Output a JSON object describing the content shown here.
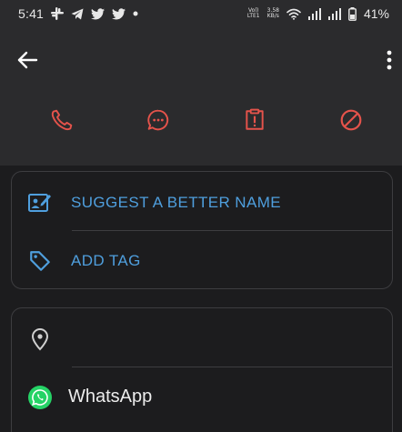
{
  "status_bar": {
    "time": "5:41",
    "left_icons": [
      "slack-icon",
      "telegram-icon",
      "twitter-icon",
      "twitter-icon",
      "dot-icon"
    ],
    "volte_top": "Vol)",
    "volte_bottom": "LTE1",
    "speed_top": "3.58",
    "speed_bottom": "KB/s",
    "battery": "41%"
  },
  "header": {
    "back_icon": "arrow-left-icon",
    "more_icon": "more-vert-icon",
    "actions": [
      {
        "name": "call",
        "icon": "phone-icon"
      },
      {
        "name": "message",
        "icon": "chat-bubble-icon"
      },
      {
        "name": "report",
        "icon": "report-icon"
      },
      {
        "name": "block",
        "icon": "block-icon"
      }
    ],
    "accent_color": "#e5534b"
  },
  "card1": {
    "suggest_label": "SUGGEST A BETTER NAME",
    "tag_label": "ADD TAG",
    "label_color": "#4f9fde"
  },
  "card2": {
    "location_icon": "location-pin-icon",
    "whatsapp_label": "WhatsApp",
    "whatsapp_color": "#25d366"
  }
}
